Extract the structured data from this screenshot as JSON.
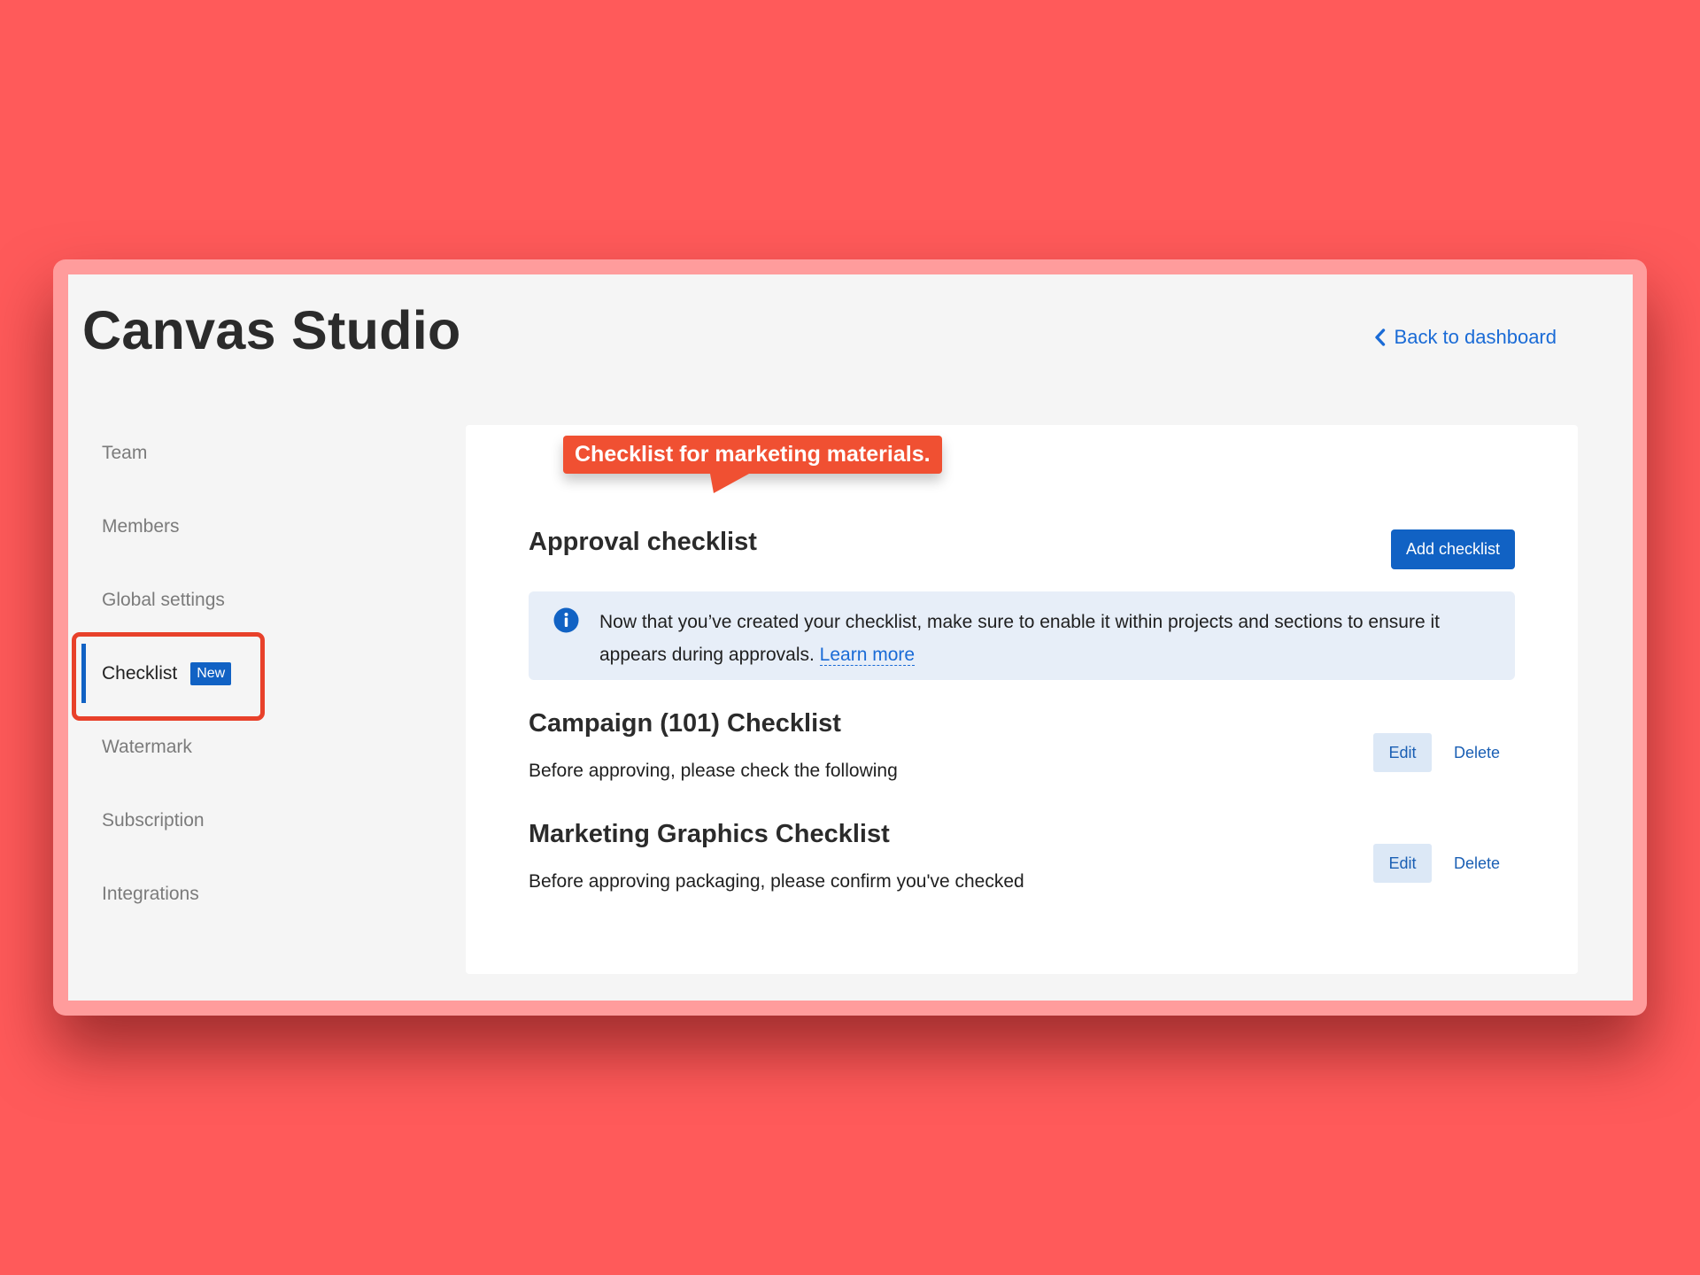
{
  "app": {
    "title": "Canvas Studio",
    "back_link": "Back to dashboard"
  },
  "sidebar": {
    "items": [
      {
        "label": "Team"
      },
      {
        "label": "Members"
      },
      {
        "label": "Global settings"
      },
      {
        "label": "Checklist",
        "badge": "New",
        "active": true
      },
      {
        "label": "Watermark"
      },
      {
        "label": "Subscription"
      },
      {
        "label": "Integrations"
      }
    ]
  },
  "annotation": {
    "callout": "Checklist for marketing materials."
  },
  "main": {
    "title": "Approval checklist",
    "add_button": "Add checklist",
    "info": {
      "text": "Now that you’ve created your checklist, make sure to enable it within projects and sections to ensure it appears during approvals.",
      "link": "Learn more"
    },
    "checklists": [
      {
        "name": "Campaign (101) Checklist",
        "description": "Before approving, please check the following",
        "edit": "Edit",
        "delete": "Delete"
      },
      {
        "name": "Marketing Graphics Checklist",
        "description": "Before approving packaging, please confirm you've checked",
        "edit": "Edit",
        "delete": "Delete"
      }
    ]
  },
  "colors": {
    "background": "#ff5a5a",
    "accent": "#1162c4",
    "highlight": "#e8412a",
    "callout": "#f05032"
  },
  "icons": {
    "back": "chevron-left-icon",
    "info": "info-icon"
  }
}
